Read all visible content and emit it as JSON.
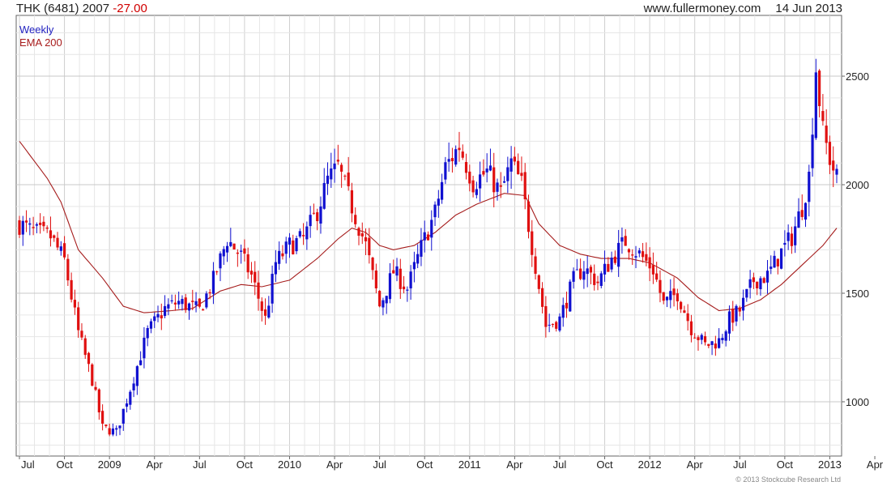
{
  "header": {
    "symbol": "THK (6481) 2007",
    "change": "-27.00",
    "site": "www.fullermoney.com",
    "date": "14 Jun 2013"
  },
  "legend": {
    "weekly": "Weekly",
    "ema": "EMA 200"
  },
  "copyright": "© 2013 Stockcube Research Ltd",
  "colors": {
    "up": "#1010d0",
    "down": "#e01010",
    "ema": "#a51c1c",
    "grid": "#d8d8d8"
  },
  "chart_data": {
    "type": "candlestick",
    "x_tick_labels": [
      "Jul",
      "Oct",
      "2009",
      "Apr",
      "Jul",
      "Oct",
      "2010",
      "Apr",
      "Jul",
      "Oct",
      "2011",
      "Apr",
      "Jul",
      "Oct",
      "2012",
      "Apr",
      "Jul",
      "Oct",
      "2013",
      "Apr"
    ],
    "y_ticks": [
      1000,
      1500,
      2000,
      2500
    ],
    "ylim": [
      750,
      2780
    ],
    "grid": true,
    "candle_anchors_close": [
      [
        0,
        1820
      ],
      [
        4,
        1780
      ],
      [
        9,
        1760
      ],
      [
        13,
        1650
      ],
      [
        17,
        1320
      ],
      [
        21,
        1100
      ],
      [
        24,
        880
      ],
      [
        28,
        860
      ],
      [
        32,
        1060
      ],
      [
        37,
        1320
      ],
      [
        42,
        1430
      ],
      [
        46,
        1460
      ],
      [
        52,
        1420
      ],
      [
        56,
        1560
      ],
      [
        60,
        1750
      ],
      [
        64,
        1670
      ],
      [
        67,
        1580
      ],
      [
        71,
        1380
      ],
      [
        74,
        1640
      ],
      [
        78,
        1720
      ],
      [
        82,
        1750
      ],
      [
        86,
        1880
      ],
      [
        89,
        2020
      ],
      [
        92,
        2080
      ],
      [
        96,
        1900
      ],
      [
        100,
        1720
      ],
      [
        104,
        1440
      ],
      [
        108,
        1600
      ],
      [
        112,
        1520
      ],
      [
        116,
        1710
      ],
      [
        120,
        1870
      ],
      [
        123,
        2080
      ],
      [
        127,
        2180
      ],
      [
        131,
        2010
      ],
      [
        135,
        2060
      ],
      [
        139,
        1960
      ],
      [
        142,
        2100
      ],
      [
        145,
        2000
      ],
      [
        148,
        1720
      ],
      [
        152,
        1350
      ],
      [
        156,
        1380
      ],
      [
        160,
        1560
      ],
      [
        163,
        1620
      ],
      [
        167,
        1550
      ],
      [
        171,
        1660
      ],
      [
        175,
        1740
      ],
      [
        179,
        1680
      ],
      [
        183,
        1610
      ],
      [
        186,
        1450
      ],
      [
        190,
        1500
      ],
      [
        194,
        1340
      ],
      [
        198,
        1260
      ],
      [
        202,
        1280
      ],
      [
        205,
        1380
      ],
      [
        208,
        1420
      ],
      [
        212,
        1560
      ],
      [
        216,
        1580
      ],
      [
        220,
        1690
      ],
      [
        223,
        1760
      ],
      [
        226,
        1900
      ],
      [
        228,
        2040
      ],
      [
        230,
        2540
      ],
      [
        232,
        2240
      ],
      [
        234,
        2120
      ],
      [
        236,
        2030
      ]
    ],
    "ema_anchors": [
      [
        0,
        2200
      ],
      [
        8,
        2030
      ],
      [
        12,
        1920
      ],
      [
        17,
        1700
      ],
      [
        24,
        1570
      ],
      [
        30,
        1440
      ],
      [
        36,
        1410
      ],
      [
        44,
        1420
      ],
      [
        50,
        1430
      ],
      [
        58,
        1510
      ],
      [
        64,
        1540
      ],
      [
        70,
        1530
      ],
      [
        78,
        1560
      ],
      [
        86,
        1660
      ],
      [
        92,
        1750
      ],
      [
        96,
        1800
      ],
      [
        100,
        1780
      ],
      [
        104,
        1720
      ],
      [
        108,
        1700
      ],
      [
        114,
        1720
      ],
      [
        120,
        1780
      ],
      [
        126,
        1860
      ],
      [
        132,
        1910
      ],
      [
        140,
        1960
      ],
      [
        146,
        1950
      ],
      [
        150,
        1820
      ],
      [
        156,
        1720
      ],
      [
        162,
        1680
      ],
      [
        168,
        1660
      ],
      [
        176,
        1660
      ],
      [
        182,
        1640
      ],
      [
        190,
        1570
      ],
      [
        196,
        1480
      ],
      [
        202,
        1420
      ],
      [
        208,
        1430
      ],
      [
        214,
        1470
      ],
      [
        220,
        1540
      ],
      [
        226,
        1630
      ],
      [
        232,
        1720
      ],
      [
        236,
        1800
      ]
    ],
    "weeks": 237
  }
}
